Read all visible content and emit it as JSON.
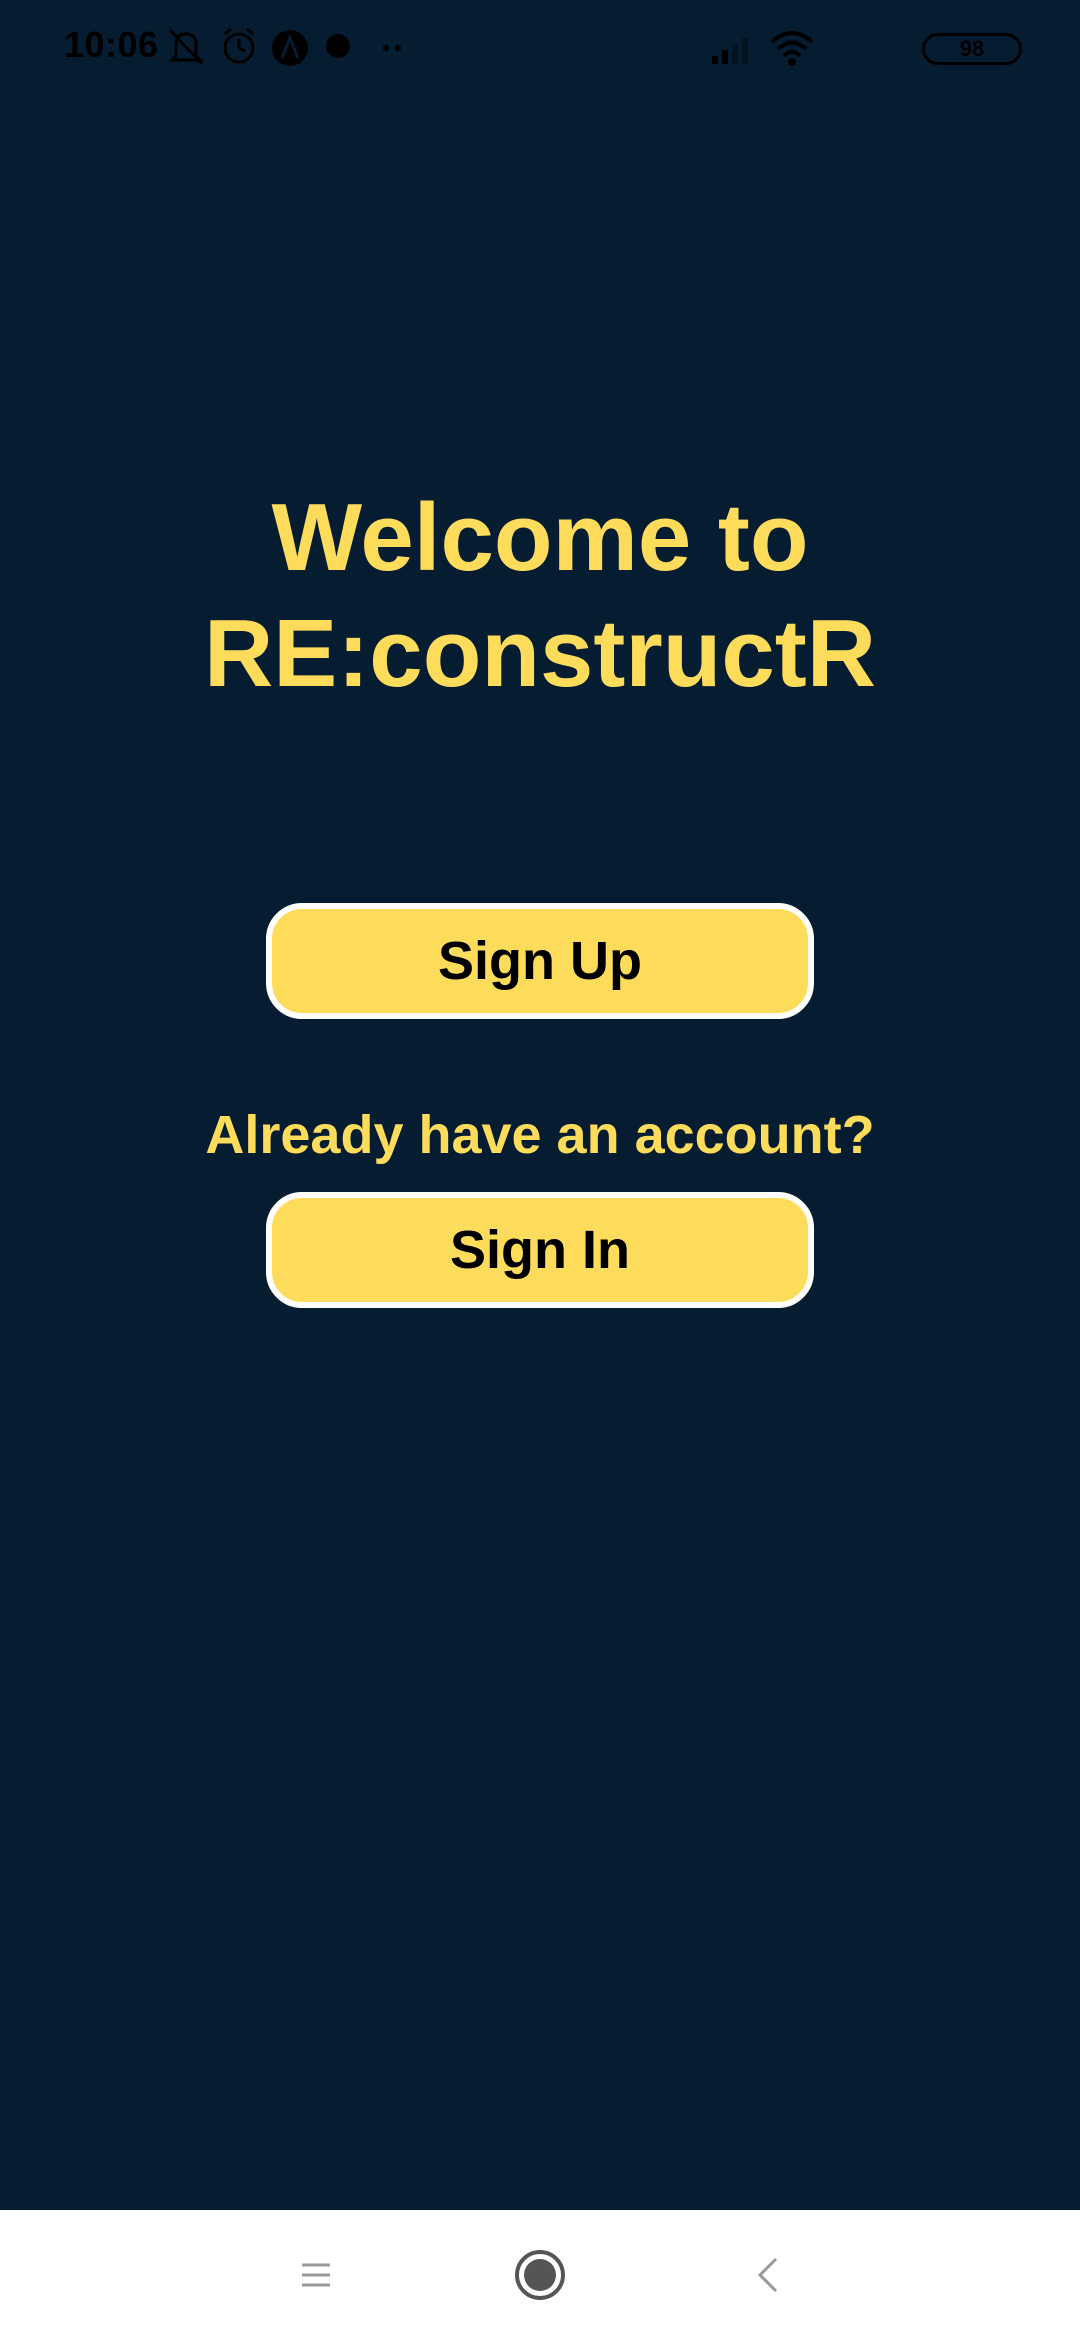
{
  "status_bar": {
    "time": "10:06",
    "battery": "98",
    "icons": [
      "mute-icon",
      "alarm-icon",
      "app-icon",
      "dot-icon",
      "more-icon",
      "signal-icon",
      "wifi-icon",
      "battery-icon"
    ]
  },
  "welcome": {
    "line1": "Welcome to",
    "line2": "RE:constructR"
  },
  "buttons": {
    "sign_up": "Sign Up",
    "sign_in": "Sign In"
  },
  "already_account_text": "Already have an account?",
  "nav_bar": {
    "icons": [
      "menu-icon",
      "home-icon",
      "back-icon"
    ]
  },
  "colors": {
    "background": "#061d31",
    "accent": "#fddc5c",
    "button_border": "#ffffff",
    "nav_bar": "#ffffff"
  }
}
